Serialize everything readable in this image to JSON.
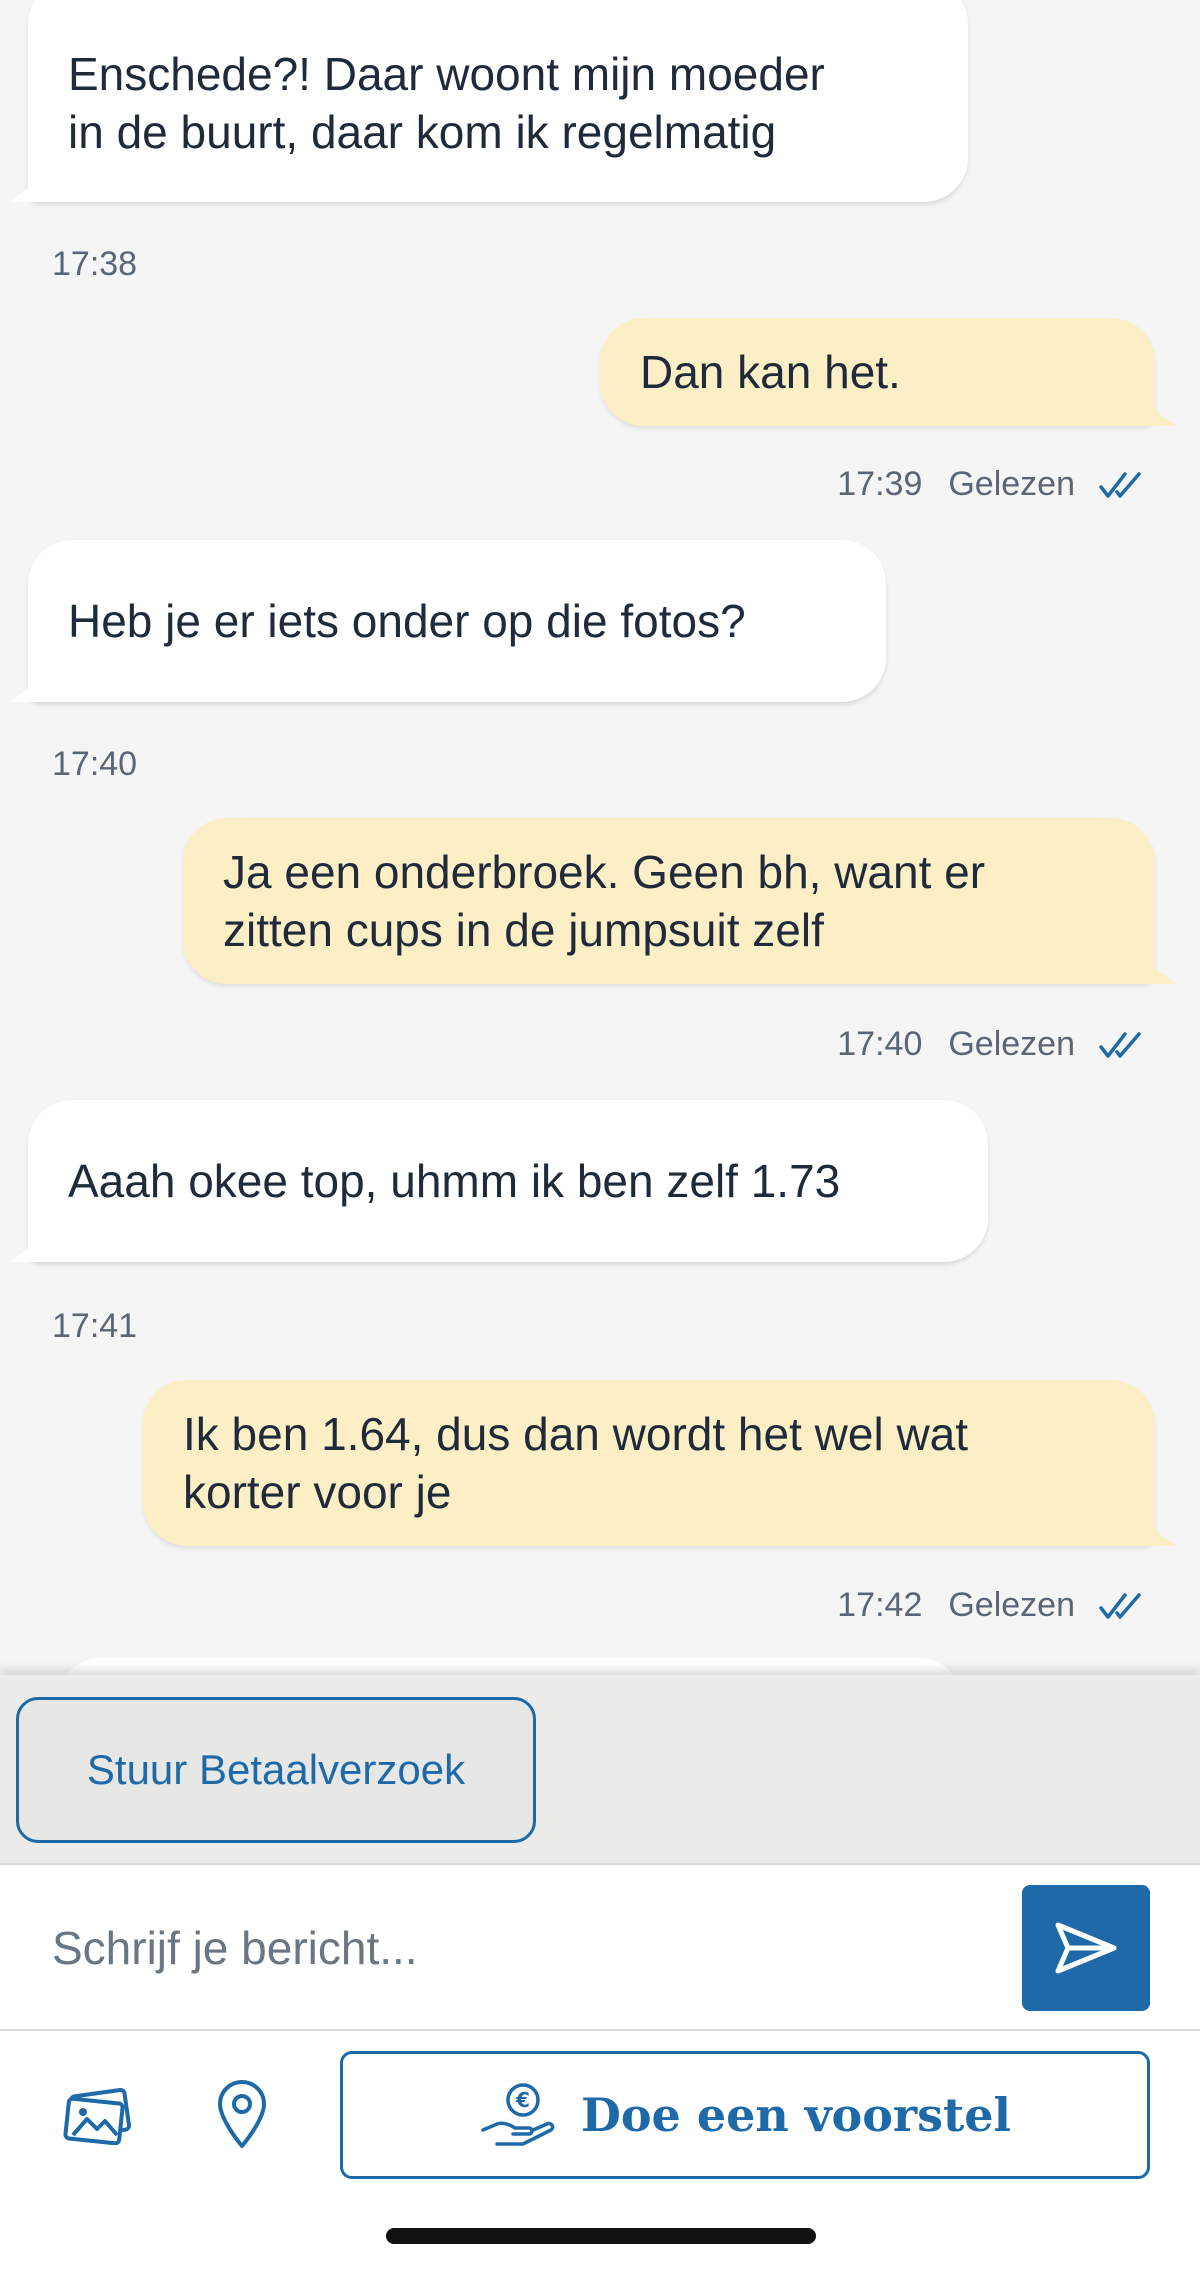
{
  "colors": {
    "accent": "#1e6aa8",
    "incoming_bubble": "#ffffff",
    "outgoing_bubble": "#fcefc6",
    "background": "#f5f5f5"
  },
  "messages": [
    {
      "direction": "incoming",
      "lines": [
        "Enschede?! Daar woont mijn moeder",
        "in de buurt, daar kom ik regelmatig"
      ],
      "time": "17:38"
    },
    {
      "direction": "outgoing",
      "lines": [
        "Dan kan het."
      ],
      "time": "17:39",
      "status": "Gelezen"
    },
    {
      "direction": "incoming",
      "lines": [
        "Heb je er iets onder op die fotos?"
      ],
      "time": "17:40"
    },
    {
      "direction": "outgoing",
      "lines": [
        "Ja een onderbroek. Geen bh, want er",
        "zitten cups in de jumpsuit zelf"
      ],
      "time": "17:40",
      "status": "Gelezen"
    },
    {
      "direction": "incoming",
      "lines": [
        "Aaah okee top, uhmm ik ben zelf 1.73"
      ],
      "time": "17:41"
    },
    {
      "direction": "outgoing",
      "lines": [
        "Ik ben 1.64, dus dan wordt het wel wat",
        "korter voor je"
      ],
      "time": "17:42",
      "status": "Gelezen"
    }
  ],
  "actions": {
    "payment_request_label": "Stuur Betaalverzoek"
  },
  "composer": {
    "placeholder": "Schrijf je bericht...",
    "value": ""
  },
  "toolbar": {
    "photos_icon": "photos-icon",
    "location_icon": "location-pin-icon",
    "offer_icon": "hand-euro-icon",
    "offer_label": "Doe een voorstel"
  }
}
